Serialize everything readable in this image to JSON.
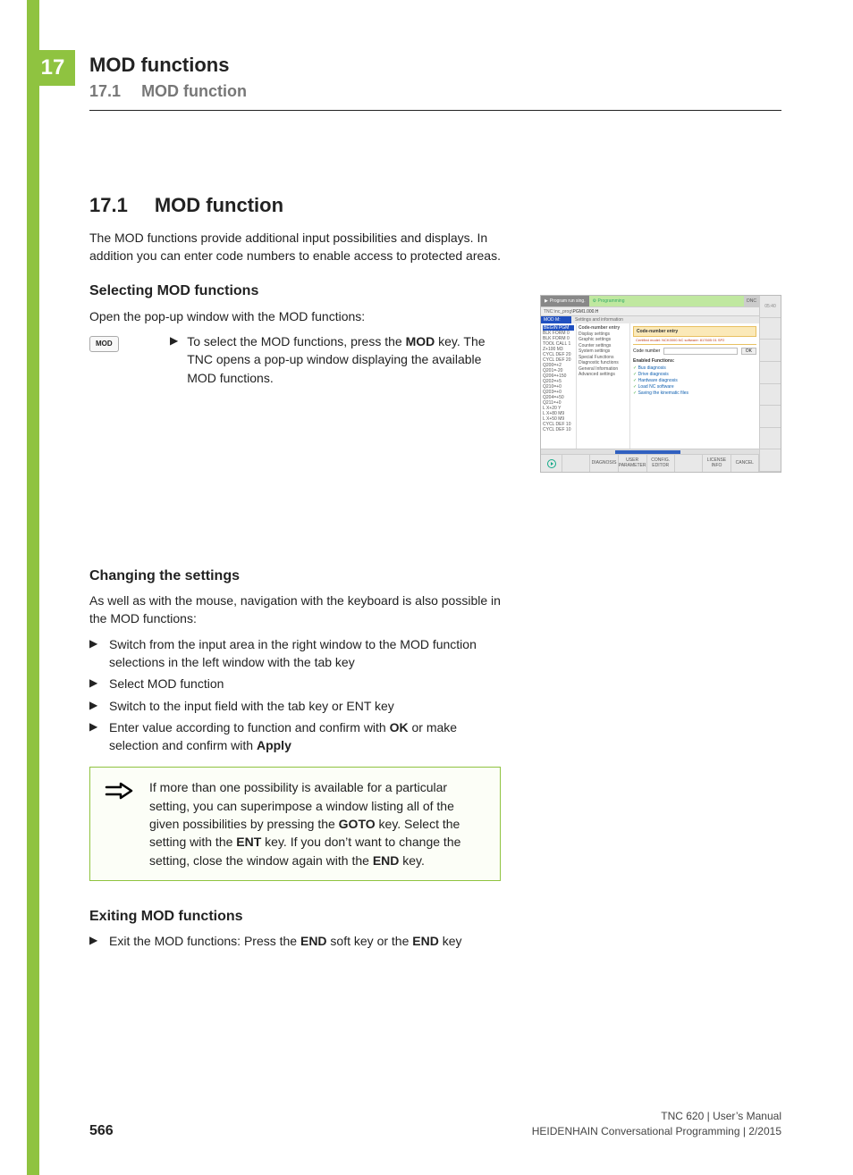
{
  "chapter_number": "17",
  "header": {
    "title": "MOD functions",
    "sub_num": "17.1",
    "sub_title": "MOD function"
  },
  "sec1": {
    "num": "17.1",
    "title": "MOD function",
    "intro": "The MOD functions provide additional input possibilities and displays. In addition you can enter code numbers to enable access to protected areas."
  },
  "selecting": {
    "h": "Selecting MOD functions",
    "lead": "Open the pop-up window with the MOD functions:",
    "key_label": "MOD",
    "step_pre": "To select the MOD functions, press the ",
    "step_bold": "MOD",
    "step_post": " key. The TNC opens a pop-up window displaying the available MOD functions."
  },
  "changing": {
    "h": "Changing the settings",
    "lead": "As well as with the mouse, navigation with the keyboard is also possible in the MOD functions:",
    "steps": [
      "Switch from the input area in the right window to the MOD function selections in the left window with the tab key",
      "Select MOD function",
      "Switch to the input field with the tab key or ENT key"
    ],
    "step4_pre": "Enter value according to function and confirm with ",
    "step4_b1": "OK",
    "step4_mid": " or make selection and confirm with ",
    "step4_b2": "Apply"
  },
  "note": {
    "t1": "If more than one possibility is available for a particular setting, you can superimpose a window listing all of the given possibilities by pressing the ",
    "b1": "GOTO",
    "t2": " key. Select the setting with the ",
    "b2": "ENT",
    "t3": " key. If you don’t want to change the setting, close the window again with the ",
    "b3": "END",
    "t4": " key."
  },
  "exiting": {
    "h": "Exiting MOD functions",
    "t1": "Exit the MOD functions: Press the ",
    "b1": "END",
    "t2": " soft key or the ",
    "b2": "END",
    "t3": " key"
  },
  "footer": {
    "page": "566",
    "line1": "TNC 620 | User’s Manual",
    "line2": "HEIDENHAIN Conversational Programming | 2/2015"
  },
  "ss": {
    "tab1": "Program run sing.",
    "tab2": "Programming",
    "dnc": "DNC",
    "rb": "05:40",
    "sub_prefix": "TNC:\\nc_prog\\",
    "sub_file": "PGM1.000.H",
    "bar1": "MOD M:",
    "bar2": "Settings and information",
    "col1": [
      "BEGIN PGM",
      "BLK FORM 0",
      "BLK FORM 0",
      "TOOL CALL 1",
      "Z+100 M3",
      "CYCL DEF 20",
      "CYCL DEF 20",
      "Q200=+2",
      "Q201=-20",
      "Q206=+150",
      "Q202=+5",
      "Q210=+0",
      "Q203=+0",
      "Q204=+50",
      "Q211=+0",
      "L X+20 Y",
      "L X+80 M9",
      "L X+50 M9",
      "CYCL DEF 10",
      "CYCL DEF 10"
    ],
    "col2": [
      "Code-number entry",
      "Display settings",
      "Graphic settings",
      "Counter settings",
      "System settings",
      "Special Functions",
      "Diagnostic functions",
      "General Information",
      "Advanced settings"
    ],
    "cne_title": "Code-number entry",
    "cne_sub": "Certified model: NCK0000.NC software: 817605 01 SP2",
    "cn_label": "Code number",
    "ok": "OK",
    "ef": "Enabled Functions:",
    "items": [
      "Bus diagnosis",
      "Drive diagnosis",
      "Hardware diagnosis",
      "Load NC software",
      "Saving the kinematic files"
    ],
    "softkeys": [
      "",
      "DIAGNOSIS",
      "USER PARAMETER",
      "CONFIG. EDITOR",
      "",
      "LICENSE INFO",
      "CANCEL"
    ]
  }
}
